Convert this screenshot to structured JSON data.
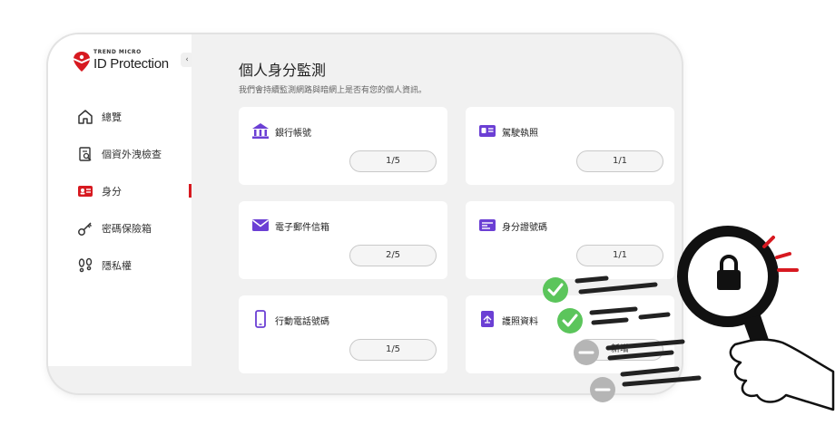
{
  "sidebar": {
    "brand": "TREND MICRO",
    "product": "ID Protection",
    "collapse_icon": "‹",
    "items": [
      {
        "label": "總覽",
        "icon": "home-icon"
      },
      {
        "label": "個資外洩檢查",
        "icon": "document-search-icon"
      },
      {
        "label": "身分",
        "icon": "id-card-icon",
        "active": true
      },
      {
        "label": "密碼保險箱",
        "icon": "key-icon"
      },
      {
        "label": "隱私權",
        "icon": "footprints-icon"
      }
    ]
  },
  "main": {
    "title": "個人身分監測",
    "subtitle": "我們會持續監測網路與暗網上是否有您的個人資訊。",
    "cards": [
      {
        "label": "銀行帳號",
        "count": "1/5",
        "icon": "bank-icon"
      },
      {
        "label": "駕駛執照",
        "count": "1/1",
        "icon": "license-icon"
      },
      {
        "label": "電子郵件信箱",
        "count": "2/5",
        "icon": "envelope-icon"
      },
      {
        "label": "身分證號碼",
        "count": "1/1",
        "icon": "id-number-icon"
      },
      {
        "label": "行動電話號碼",
        "count": "1/5",
        "icon": "phone-icon"
      },
      {
        "label": "護照資料",
        "count": "新增",
        "icon": "passport-icon"
      }
    ]
  },
  "colors": {
    "accent": "#d71920",
    "icon_purple": "#6b3fd4",
    "check_green": "#5bc55b",
    "pending_gray": "#b5b5b5"
  }
}
